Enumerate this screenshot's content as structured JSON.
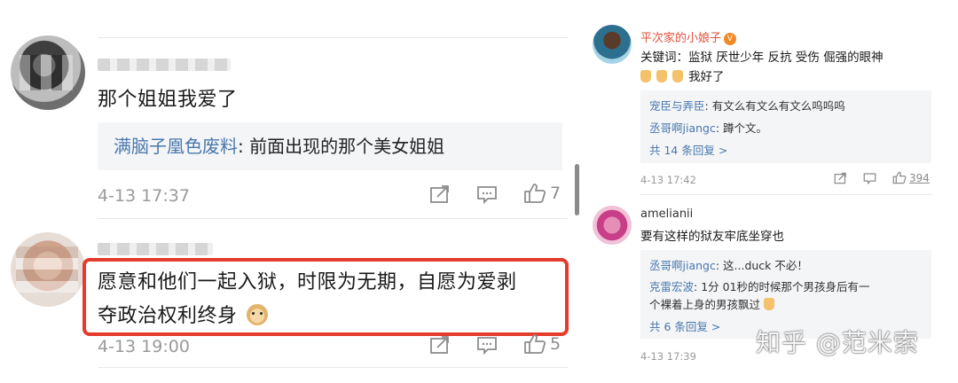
{
  "left": {
    "comment1": {
      "text": "那个姐姐我爱了",
      "reply": {
        "name": "满脑子凰色废料",
        "separator": ": ",
        "text": "前面出现的那个美女姐姐"
      },
      "time": "4-13 17:37",
      "like_count": "7"
    },
    "comment2": {
      "line1": "愿意和他们一起入狱，时限为无期，自愿为爱剥",
      "line2": "夺政治权利终身",
      "time": "4-13 19:00",
      "like_count": "5"
    }
  },
  "right": {
    "comment1": {
      "author": "平次家的小娘子",
      "badge": "V",
      "keywords": "关键词：监狱 厌世少年 反抗 受伤 倔强的眼神",
      "reaction": "我好了",
      "replies": [
        {
          "name": "宠臣与弄臣",
          "text": ": 有文么有文么有文么呜呜呜"
        },
        {
          "name": "丞哥啊jiangc",
          "text": ": 蹲个文。"
        }
      ],
      "more": "共 14 条回复 >",
      "time": "4-13 17:42",
      "like_count": "394"
    },
    "comment2": {
      "author": "amelianii",
      "text": "要有这样的狱友牢底坐穿也",
      "replies": [
        {
          "name": "丞哥啊jiangc",
          "text": ": 这...duck 不必！"
        },
        {
          "name": "克雷宏波",
          "text": ": 1分 01秒的时候那个男孩身后有一"
        },
        {
          "name": "",
          "text": "个裸着上身的男孩飘过"
        }
      ],
      "more": "共 6 条回复 >",
      "time": "4-13 17:39"
    }
  },
  "watermark": "知乎 @范米索",
  "colors": {
    "link": "#4a78ad",
    "highlight": "#e53b2c",
    "author": "#e0533d"
  }
}
